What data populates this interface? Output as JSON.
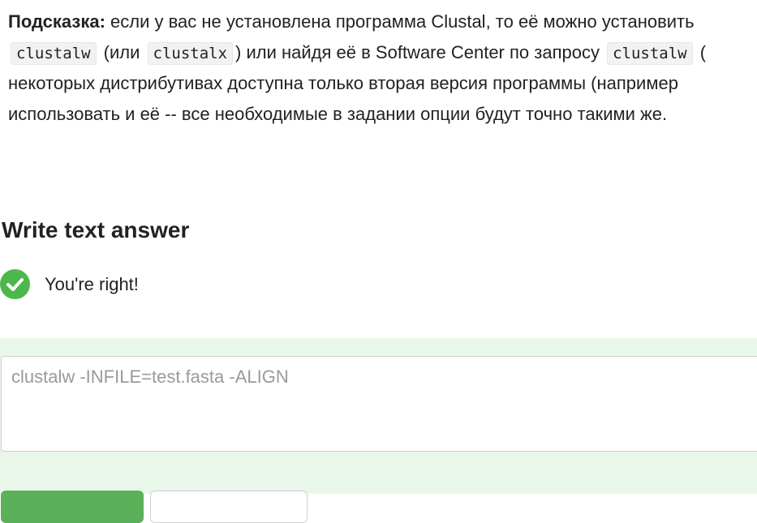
{
  "hint": {
    "label": "Подсказка:",
    "line1_text": " если у вас не установлена программа Clustal, то её можно установить",
    "code1": "clustalw",
    "line2_mid1": "(или",
    "code2": "clustalx",
    "line2_mid2": ") или найдя её в Software Center по запросу",
    "code3": "clustalw",
    "line2_end": "(",
    "line3": "некоторых дистрибутивах доступна только вторая версия программы (например",
    "line4": "использовать и её -- все необходимые в задании опции будут точно такими же."
  },
  "section": {
    "title": "Write text answer"
  },
  "feedback": {
    "icon": "check-circle-icon",
    "text": "You're right!",
    "color": "#4cb84c"
  },
  "answer": {
    "value": "clustalw -INFILE=test.fasta -ALIGN"
  },
  "colors": {
    "panel_bg": "#e9f7ea",
    "primary_button": "#5ab15a"
  }
}
